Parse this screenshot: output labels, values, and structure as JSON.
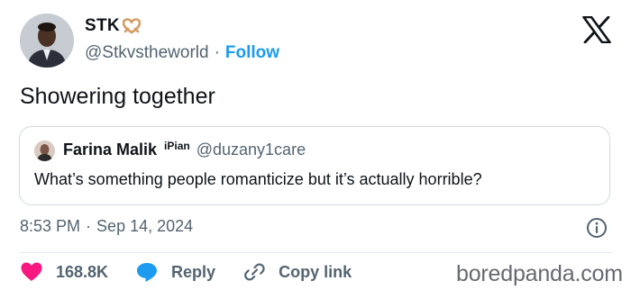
{
  "author": {
    "display_name": "STK",
    "name_emoji_icon": "heart-hands-icon",
    "handle": "@Stkvstheworld",
    "separator": "·",
    "follow_label": "Follow"
  },
  "tweet": {
    "text": "Showering together",
    "time": "8:53 PM",
    "separator": "·",
    "date": "Sep 14, 2024"
  },
  "quoted": {
    "display_name": "Farina Malik",
    "badge": "iPian",
    "handle": "@duzany1care",
    "text": "What’s something people romanticize but it’s actually horrible?"
  },
  "actions": {
    "like_count": "168.8K",
    "reply_label": "Reply",
    "copy_label": "Copy link"
  },
  "watermark": "boredpanda.com",
  "colors": {
    "like": "#f91880",
    "reply": "#1d9bf0",
    "follow": "#1d9bf0",
    "muted": "#536471"
  }
}
